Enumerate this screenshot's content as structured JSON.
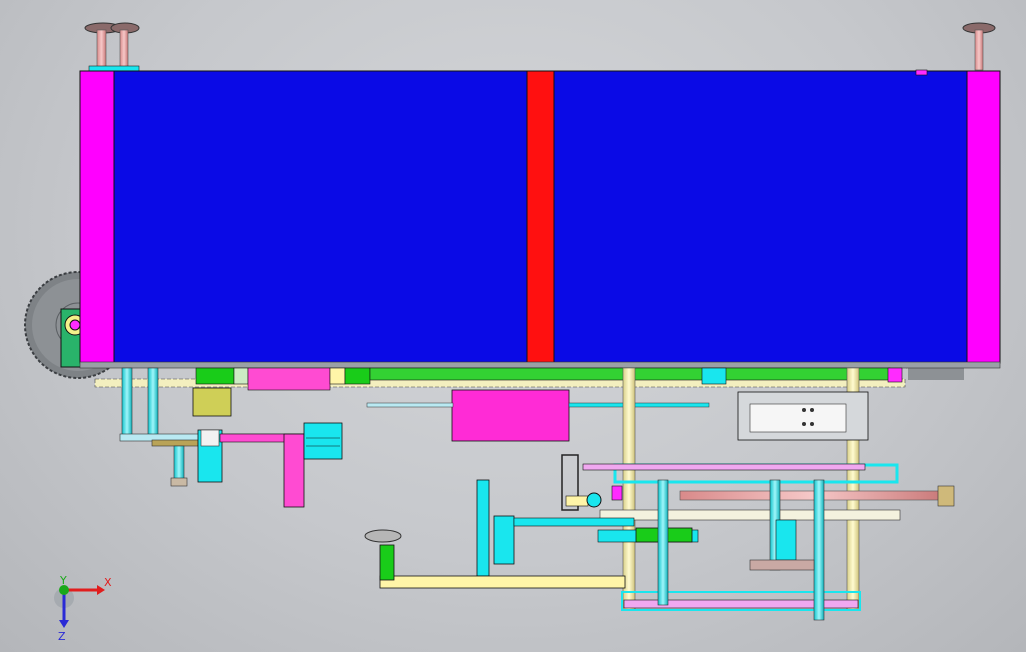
{
  "viewport": {
    "background": "#c9cbce",
    "colors": {
      "panel": "#0a0ae6",
      "magenta": "#ff00ff",
      "red": "#ff1010",
      "cyan": "#19e6ee",
      "green": "#19cc19",
      "yellow": "#fff5a8",
      "pink": "#f0a8f0",
      "olive": "#cfcf57",
      "salmon": "#f4a09a",
      "lightblue": "#b9e9f2"
    }
  },
  "triad": {
    "x_label": "X",
    "y_label": "Y",
    "z_label": "Z",
    "x_color": "#e11d1d",
    "y_color": "#1aa81a",
    "z_color": "#2a2ad6"
  }
}
